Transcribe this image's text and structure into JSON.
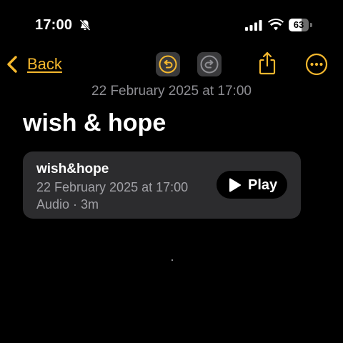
{
  "status_bar": {
    "time": "17:00",
    "battery_level": "63",
    "battery_fraction": 0.63,
    "icons": [
      "bell-slash-icon",
      "cellular-signal-icon",
      "wifi-icon",
      "battery-icon"
    ]
  },
  "nav": {
    "back_label": "Back",
    "icons": [
      "chevron-left-icon",
      "undo-icon",
      "redo-icon",
      "share-icon",
      "more-icon"
    ]
  },
  "note": {
    "date": "22 February 2025 at 17:00",
    "title": "wish & hope"
  },
  "audio_attachment": {
    "name": "wish&hope",
    "date": "22 February 2025 at 17:00",
    "meta": "Audio · 3m",
    "play_label": "Play",
    "icon": "play-icon"
  },
  "colors": {
    "accent": "#f5b82e",
    "background": "#000000",
    "card": "#2c2c2e",
    "secondary_text": "#8e8e93"
  }
}
